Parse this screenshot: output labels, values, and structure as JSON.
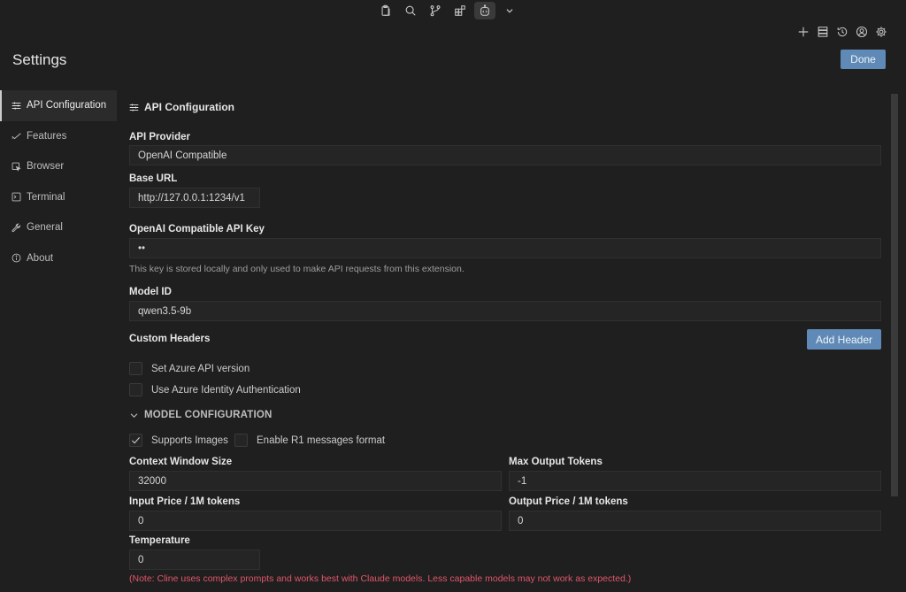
{
  "top_toolbar": {
    "icons": [
      "clipboard-icon",
      "search-icon",
      "source-control-icon",
      "extensions-icon",
      "cline-bot-icon",
      "chevron-down-icon"
    ]
  },
  "header": {
    "title": "Settings",
    "done_label": "Done",
    "icons": [
      "plus-icon",
      "database-icon",
      "history-icon",
      "account-icon",
      "gear-icon"
    ]
  },
  "sidebar": {
    "items": [
      {
        "label": "API Configuration",
        "icon": "sliders-icon",
        "active": true
      },
      {
        "label": "Features",
        "icon": "check-icon",
        "active": false
      },
      {
        "label": "Browser",
        "icon": "browser-icon",
        "active": false
      },
      {
        "label": "Terminal",
        "icon": "terminal-icon",
        "active": false
      },
      {
        "label": "General",
        "icon": "wrench-icon",
        "active": false
      },
      {
        "label": "About",
        "icon": "info-icon",
        "active": false
      }
    ]
  },
  "api": {
    "section_title": "API Configuration",
    "provider_label": "API Provider",
    "provider_value": "OpenAI Compatible",
    "base_url_label": "Base URL",
    "base_url_value": "http://127.0.0.1:1234/v1",
    "api_key_label": "OpenAI Compatible API Key",
    "api_key_value": "••",
    "api_key_hint": "This key is stored locally and only used to make API requests from this extension.",
    "model_id_label": "Model ID",
    "model_id_value": "qwen3.5-9b",
    "custom_headers_label": "Custom Headers",
    "add_header_label": "Add Header",
    "azure_version_label": "Set Azure API version",
    "azure_identity_label": "Use Azure Identity Authentication"
  },
  "model_config": {
    "title": "MODEL CONFIGURATION",
    "supports_images_label": "Supports Images",
    "supports_images_checked": true,
    "r1_format_label": "Enable R1 messages format",
    "r1_format_checked": false,
    "context_window_label": "Context Window Size",
    "context_window_value": "32000",
    "max_output_label": "Max Output Tokens",
    "max_output_value": "-1",
    "input_price_label": "Input Price / 1M tokens",
    "input_price_value": "0",
    "output_price_label": "Output Price / 1M tokens",
    "output_price_value": "0",
    "temperature_label": "Temperature",
    "temperature_value": "0"
  },
  "note": "(Note: Cline uses complex prompts and works best with Claude models. Less capable models may not work as expected.)",
  "colors": {
    "background": "#1f1f1f",
    "accent_button": "#5f89b6",
    "note_text": "#e0566a"
  }
}
